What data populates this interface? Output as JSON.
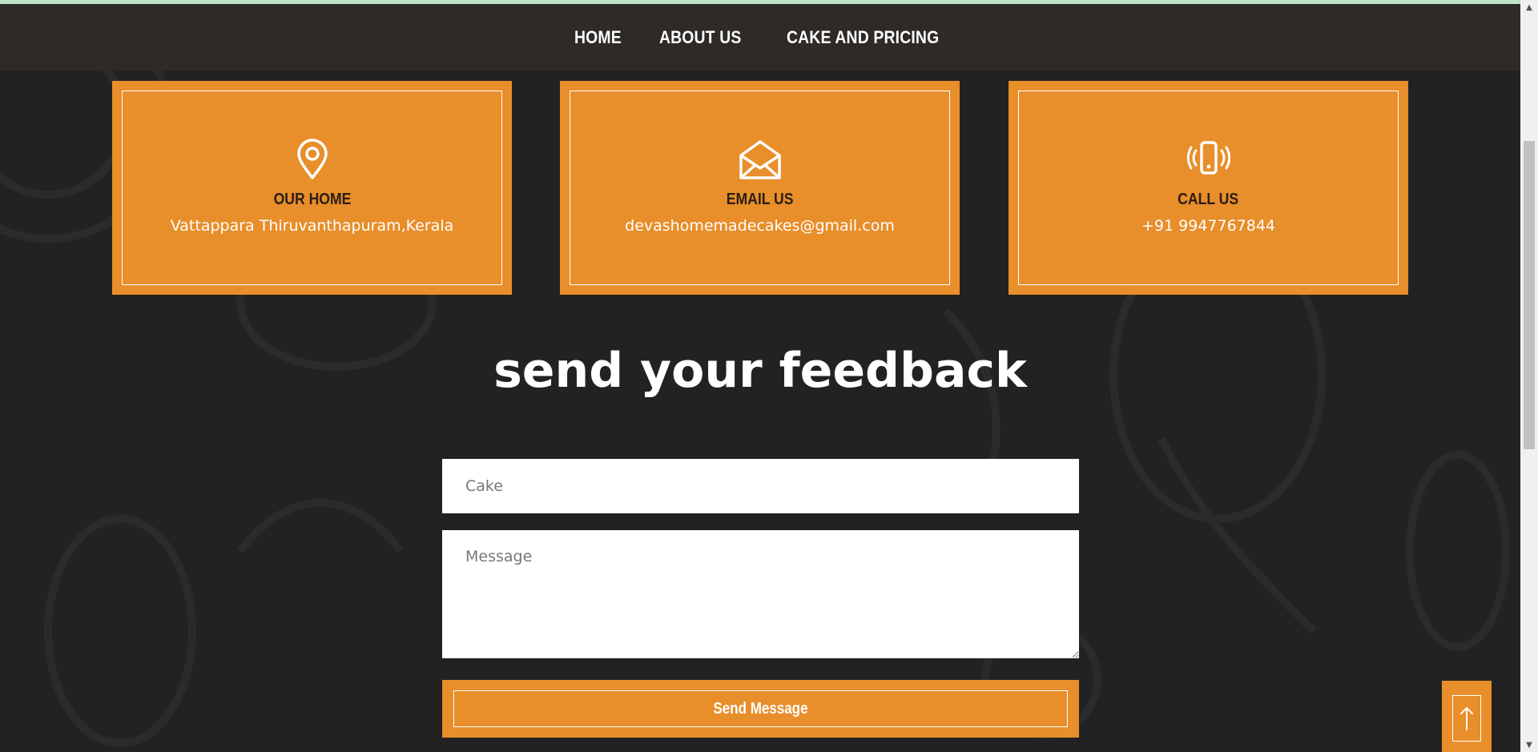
{
  "nav": {
    "items": [
      {
        "label": "HOME"
      },
      {
        "label": "ABOUT US"
      },
      {
        "label": "CAKE AND PRICING"
      }
    ]
  },
  "contact_cards": [
    {
      "icon": "map-pin-icon",
      "title": "OUR HOME",
      "value": "Vattappara Thiruvanthapuram,Kerala"
    },
    {
      "icon": "envelope-open-icon",
      "title": "EMAIL US",
      "value": "devashomemadecakes@gmail.com"
    },
    {
      "icon": "phone-vibrate-icon",
      "title": "CALL US",
      "value": "+91 9947767844"
    }
  ],
  "feedback": {
    "title": "send your feedback",
    "cake_placeholder": "Cake",
    "message_placeholder": "Message",
    "submit_label": "Send Message"
  },
  "scroll_to_top": {
    "icon": "arrow-up-icon"
  },
  "colors": {
    "accent": "#e88e2a",
    "navbar": "#2e2a27",
    "background": "#232222",
    "card_title": "#2a1e14"
  }
}
